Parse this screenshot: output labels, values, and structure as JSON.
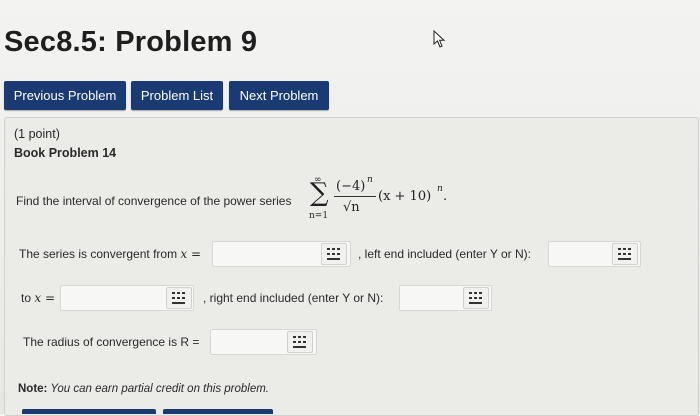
{
  "header": {
    "title": "Sec8.5: Problem 9"
  },
  "nav": {
    "previous_label": "Previous Problem",
    "list_label": "Problem List",
    "next_label": "Next Problem"
  },
  "problem": {
    "points": "(1 point)",
    "book_ref": "Book Problem 14",
    "prompt": "Find the interval of convergence of the power series",
    "series": {
      "sum_upper": "∞",
      "sum_lower": "n=1",
      "numerator": "(−4)",
      "numerator_exp": "n",
      "denominator": "√n",
      "factor": "(x + 10)",
      "factor_exp": "n",
      "end": "."
    },
    "q1_label": "The series is convergent from",
    "q1_var": "x =",
    "q1_value": "",
    "left_end_label": ", left end included (enter Y or N):",
    "left_end_value": "",
    "q2_prefix": "to",
    "q2_var": "x =",
    "q2_value": "",
    "right_end_label": ", right end included (enter Y or N):",
    "right_end_value": "",
    "radius_label": "The radius of convergence is R =",
    "radius_value": "",
    "note_bold": "Note:",
    "note_text": " You can earn partial credit on this problem."
  },
  "colors": {
    "nav_button": "#1a3a73",
    "nav_text": "#ffffff"
  },
  "icons": {
    "keyboard": "equation-editor-icon",
    "cursor": "mouse-cursor-icon"
  }
}
